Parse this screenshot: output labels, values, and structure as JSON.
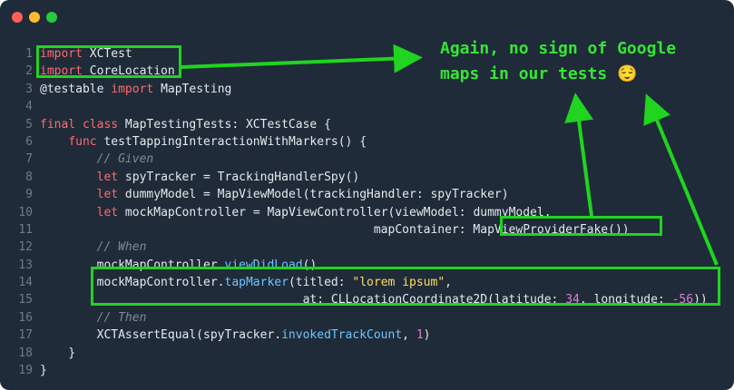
{
  "window": {
    "controls": [
      "close",
      "minimize",
      "zoom"
    ]
  },
  "code": {
    "lines": [
      {
        "n": "1",
        "parts": [
          [
            "kw",
            "import"
          ],
          [
            "src",
            " XCTest"
          ]
        ]
      },
      {
        "n": "2",
        "parts": [
          [
            "kw",
            "import"
          ],
          [
            "src",
            " CoreLocation"
          ]
        ]
      },
      {
        "n": "3",
        "parts": [
          [
            "src",
            "@testable "
          ],
          [
            "kw",
            "import"
          ],
          [
            "src",
            " MapTesting"
          ]
        ]
      },
      {
        "n": "4",
        "parts": []
      },
      {
        "n": "5",
        "parts": [
          [
            "kw",
            "final class"
          ],
          [
            "src",
            " MapTestingTests: XCTestCase {"
          ]
        ]
      },
      {
        "n": "6",
        "parts": [
          [
            "src",
            "    "
          ],
          [
            "kw",
            "func"
          ],
          [
            "src",
            " testTappingInteractionWithMarkers() {"
          ]
        ]
      },
      {
        "n": "7",
        "parts": [
          [
            "cm",
            "        // Given"
          ]
        ]
      },
      {
        "n": "8",
        "parts": [
          [
            "src",
            "        "
          ],
          [
            "kw",
            "let"
          ],
          [
            "src",
            " spyTracker = TrackingHandlerSpy()"
          ]
        ]
      },
      {
        "n": "9",
        "parts": [
          [
            "src",
            "        "
          ],
          [
            "kw",
            "let"
          ],
          [
            "src",
            " dummyModel = MapViewModel(trackingHandler: spyTracker)"
          ]
        ]
      },
      {
        "n": "10",
        "parts": [
          [
            "src",
            "        "
          ],
          [
            "kw",
            "let"
          ],
          [
            "src",
            " mockMapController = MapViewController(viewModel: dummyModel,"
          ]
        ]
      },
      {
        "n": "11",
        "parts": [
          [
            "src",
            "                                               mapContainer: MapViewProviderFake())"
          ]
        ]
      },
      {
        "n": "12",
        "parts": [
          [
            "cm",
            "        // When"
          ]
        ]
      },
      {
        "n": "13",
        "parts": [
          [
            "src",
            "        mockMapController."
          ],
          [
            "fn",
            "viewDidLoad"
          ],
          [
            "src",
            "()"
          ]
        ]
      },
      {
        "n": "14",
        "parts": [
          [
            "src",
            "        mockMapController."
          ],
          [
            "fn",
            "tapMarker"
          ],
          [
            "src",
            "(titled: "
          ],
          [
            "st",
            "\"lorem ipsum\""
          ],
          [
            "src",
            ","
          ]
        ]
      },
      {
        "n": "15",
        "parts": [
          [
            "src",
            "                                     at: CLLocationCoordinate2D(latitude: "
          ],
          [
            "nm",
            "34"
          ],
          [
            "src",
            ", longitude: "
          ],
          [
            "nm",
            "-56"
          ],
          [
            "src",
            "))"
          ]
        ]
      },
      {
        "n": "16",
        "parts": [
          [
            "cm",
            "        // Then"
          ]
        ]
      },
      {
        "n": "17",
        "parts": [
          [
            "src",
            "        XCTAssertEqual(spyTracker."
          ],
          [
            "fn",
            "invokedTrackCount"
          ],
          [
            "src",
            ", "
          ],
          [
            "nm",
            "1"
          ],
          [
            "src",
            ")"
          ]
        ]
      },
      {
        "n": "18",
        "parts": [
          [
            "src",
            "    }"
          ]
        ]
      },
      {
        "n": "19",
        "parts": [
          [
            "src",
            "}"
          ]
        ]
      }
    ]
  },
  "annotation": {
    "text_line1": "Again, no sign of Google",
    "text_line2": "maps in our tests 😌"
  },
  "colors": {
    "background": "#1f2b38",
    "highlight": "#20d420",
    "annotation": "#36e536"
  }
}
